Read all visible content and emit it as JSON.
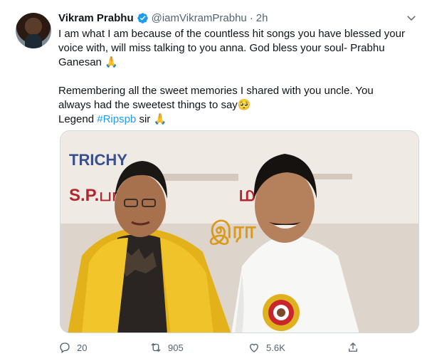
{
  "tweet": {
    "author_name": "Vikram Prabhu",
    "handle": "@iamVikramPrabhu",
    "separator": "·",
    "time": "2h",
    "line1": "I am what I am because of the countless hit songs you have blessed your voice with, will miss talking to you anna. God bless your soul- Prabhu Ganesan ",
    "emoji1": "🙏",
    "line2": "Remembering all the sweet memories I shared with you uncle. You always had the sweetest things to say",
    "emoji2": "🥺",
    "line3_prefix": "Legend ",
    "hashtag": "#Ripspb",
    "line3_suffix": " sir ",
    "emoji3": "🙏"
  },
  "media": {
    "banner_text_left": "TRICHY",
    "banner_text_2": "S.P.பால",
    "banner_text_3": "மணி",
    "banner_text_4": "இரா"
  },
  "actions": {
    "replies": "20",
    "retweets": "905",
    "likes": "5.6K"
  },
  "colors": {
    "accent": "#1d9bf0",
    "muted": "#536471"
  },
  "icons": [
    "verified-badge-icon",
    "chevron-down-icon",
    "reply-icon",
    "retweet-icon",
    "like-icon",
    "share-icon"
  ]
}
